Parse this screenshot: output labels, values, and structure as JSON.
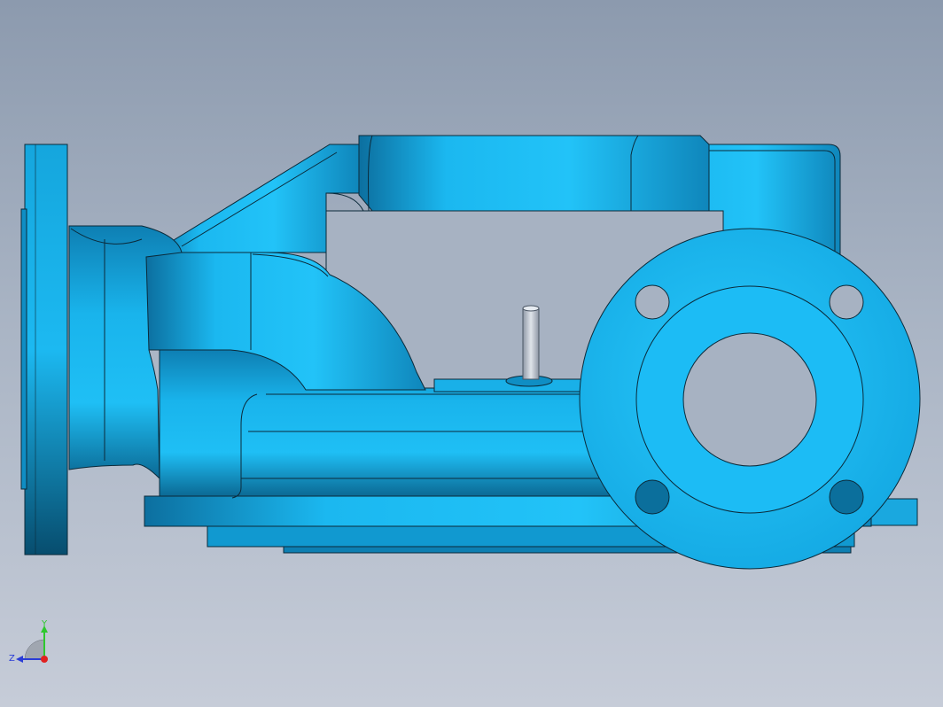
{
  "view": {
    "background_top": "#8c9aae",
    "background_bottom": "#c6ccd8",
    "model_color": "#19b4ec",
    "model_dark": "#0a6f9a",
    "edge_color": "#0b2a3a",
    "pin_color": "#b9c2cf"
  },
  "triad": {
    "y_label": "Y",
    "z_label": "Z",
    "y_color": "#2ec82e",
    "z_color": "#2a3cd6",
    "x_color": "#e02020"
  }
}
